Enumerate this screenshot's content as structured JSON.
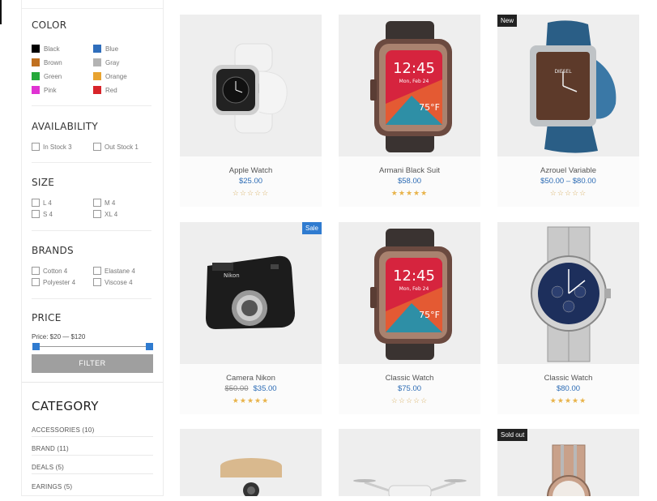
{
  "filters": {
    "color": {
      "title": "COLOR",
      "items": [
        {
          "label": "Black",
          "hex": "#000000"
        },
        {
          "label": "Blue",
          "hex": "#2f6ebc"
        },
        {
          "label": "Brown",
          "hex": "#c07020"
        },
        {
          "label": "Gray",
          "hex": "#b3b3b3"
        },
        {
          "label": "Green",
          "hex": "#25a83a"
        },
        {
          "label": "Orange",
          "hex": "#e8a330"
        },
        {
          "label": "Pink",
          "hex": "#e033d3"
        },
        {
          "label": "Red",
          "hex": "#d8242a"
        }
      ]
    },
    "availability": {
      "title": "AVAILABILITY",
      "items": [
        "In Stock 3",
        "Out Stock 1"
      ]
    },
    "size": {
      "title": "SIZE",
      "items": [
        "L 4",
        "M 4",
        "S 4",
        "XL 4"
      ]
    },
    "brands": {
      "title": "BRANDS",
      "items": [
        "Cotton 4",
        "Elastane 4",
        "Polyester 4",
        "Viscose 4"
      ]
    },
    "price": {
      "title": "PRICE",
      "range_text": "Price: $20 — $120",
      "filter_button": "FILTER",
      "min_value": 20,
      "max_value": 120
    }
  },
  "category": {
    "title": "CATEGORY",
    "items": [
      "ACCESSORIES (10)",
      "BRAND (11)",
      "DEALS (5)",
      "EARINGS (5)"
    ]
  },
  "products": [
    {
      "name": "Apple Watch",
      "price": "$25.00",
      "rating": 0,
      "image": "smartwatch-white"
    },
    {
      "name": "Armani Black Suit",
      "price": "$58.00",
      "rating": 5,
      "image": "smartwatch-dark"
    },
    {
      "name": "Azrouel Variable",
      "price": "$50.00 – $80.00",
      "rating": 0,
      "badge": "New",
      "image": "analog-watch-blue"
    },
    {
      "name": "Camera Nikon",
      "old_price": "$50.00",
      "price": "$35.00",
      "rating": 5,
      "badge": "Sale",
      "image": "camera"
    },
    {
      "name": "Classic Watch",
      "price": "$75.00",
      "rating": 0,
      "image": "smartwatch-dark"
    },
    {
      "name": "Classic Watch",
      "price": "$80.00",
      "rating": 5,
      "image": "chronograph-steel"
    },
    {
      "name": "",
      "price": "",
      "rating": 0,
      "image": "speaker-wood"
    },
    {
      "name": "",
      "price": "",
      "rating": 0,
      "image": "drone"
    },
    {
      "name": "",
      "price": "",
      "rating": 0,
      "badge": "Sold out",
      "image": "rose-gold-watch"
    }
  ]
}
